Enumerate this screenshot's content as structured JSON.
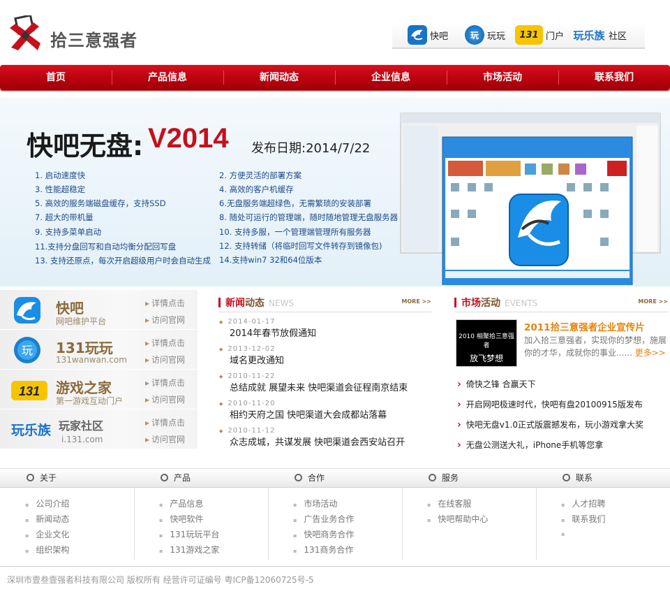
{
  "header": {
    "logo_text": "拾三意强者",
    "portals": [
      {
        "label": "快吧",
        "icon": "shark-icon"
      },
      {
        "label": "玩玩",
        "icon": "wan-icon"
      },
      {
        "label": "门户",
        "icon": "131-icon"
      },
      {
        "label": "社区",
        "icon": "wanlezu-icon"
      }
    ],
    "portal_logos": {
      "p3": "131",
      "p4": "玩乐族"
    }
  },
  "nav": [
    "首页",
    "产品信息",
    "新闻动态",
    "企业信息",
    "市场活动",
    "联系我们"
  ],
  "banner": {
    "title": "快吧无盘:",
    "version": "V2014",
    "date": "发布日期:2014/7/22",
    "features_left": [
      "1. 启动速度快",
      "3. 性能超稳定",
      "5. 高效的服务端磁盘缓存，支持SSD",
      "7. 超大的带机量",
      "9. 支持多菜单启动",
      "11.支持分盘回写和自动均衡分配回写盘",
      "13. 支持还原点，每次开启超级用户时会自动生成"
    ],
    "features_right": [
      "2. 方便灵活的部署方案",
      "4. 高效的客户机缓存",
      "6.无盘服务端超绿色，无需繁琐的安装部署",
      "8. 随处可运行的管理端，随时随地管理无盘服务器",
      "10. 支持多服，一个管理端管理所有服务器",
      "12. 支持转储（将临时回写文件转存到镜像包)",
      "14.支持win7 32和64位版本"
    ]
  },
  "side": [
    {
      "t1": "快吧",
      "t2": "网吧维护平台",
      "l1": "详情点击",
      "l2": "访问官网"
    },
    {
      "t1": "131玩玩",
      "t2": "131wanwan.com",
      "l1": "详情点击",
      "l2": "访问官网"
    },
    {
      "t1": "游戏之家",
      "t2": "第一游戏互动门户",
      "l1": "详情点击",
      "l2": "访问官网"
    },
    {
      "t1": "玩家社区",
      "t2": "i.131.com",
      "l1": "详情点击",
      "l2": "访问官网"
    }
  ],
  "side_logos": {
    "s1": "快",
    "s2": "玩",
    "s3": "131",
    "s4": "玩乐族"
  },
  "news": {
    "title_a": "新闻",
    "title_b": "动态",
    "en": "NEWS",
    "more": "MORE >>",
    "items": [
      {
        "date": "2014-01-17",
        "title": "2014年春节放假通知"
      },
      {
        "date": "2013-12-02",
        "title": "域名更改通知"
      },
      {
        "date": "2010-11-22",
        "title": "总结成就 展望未来 快吧渠道会征程南京结束"
      },
      {
        "date": "2010-11-20",
        "title": "相约天府之国 快吧渠道大会成都站落幕"
      },
      {
        "date": "2010-11-12",
        "title": "众志成城，共谋发展 快吧渠道会西安站召开"
      }
    ]
  },
  "market": {
    "title_a": "市场",
    "title_b": "活动",
    "en": "EVENTS",
    "more": "MORE >>",
    "feature_img_line1": "2010 相聚拾三意强者",
    "feature_img_line2": "放飞梦想",
    "feature_title": "2011拾三意强者企业宣传片",
    "feature_desc": "加入拾三意强者，实现你的梦想，施展你的才华，成就你的事业......",
    "feature_more": "更多>>",
    "items": [
      "倚快之锋 合赢天下",
      "开启网吧极速时代，快吧有盘20100915版发布",
      "快吧无盘v1.0正式版震撼发布，玩小游戏拿大奖",
      "无盘公测送大礼，iPhone手机等您拿"
    ]
  },
  "footer": {
    "heads": [
      "关于",
      "产品",
      "合作",
      "服务",
      "联系"
    ],
    "cols": [
      [
        "公司介绍",
        "新闻动态",
        "企业文化",
        "组织架构"
      ],
      [
        "产品信息",
        "快吧软件",
        "131玩玩平台",
        "131游戏之家"
      ],
      [
        "市场活动",
        "广告业务合作",
        "快吧商务合作",
        "131商务合作"
      ],
      [
        "在线客服",
        "快吧帮助中心"
      ],
      [
        "人才招聘",
        "联系我们",
        ""
      ]
    ],
    "copyright": "深圳市壹叁壹强者科技有限公司 版权所有 经营许可证编号 粤ICP备12060725号-5"
  },
  "colors": {
    "brand_red": "#c4101d",
    "feature_orange": "#e8820c",
    "feature_blue": "#1e4a8a"
  }
}
